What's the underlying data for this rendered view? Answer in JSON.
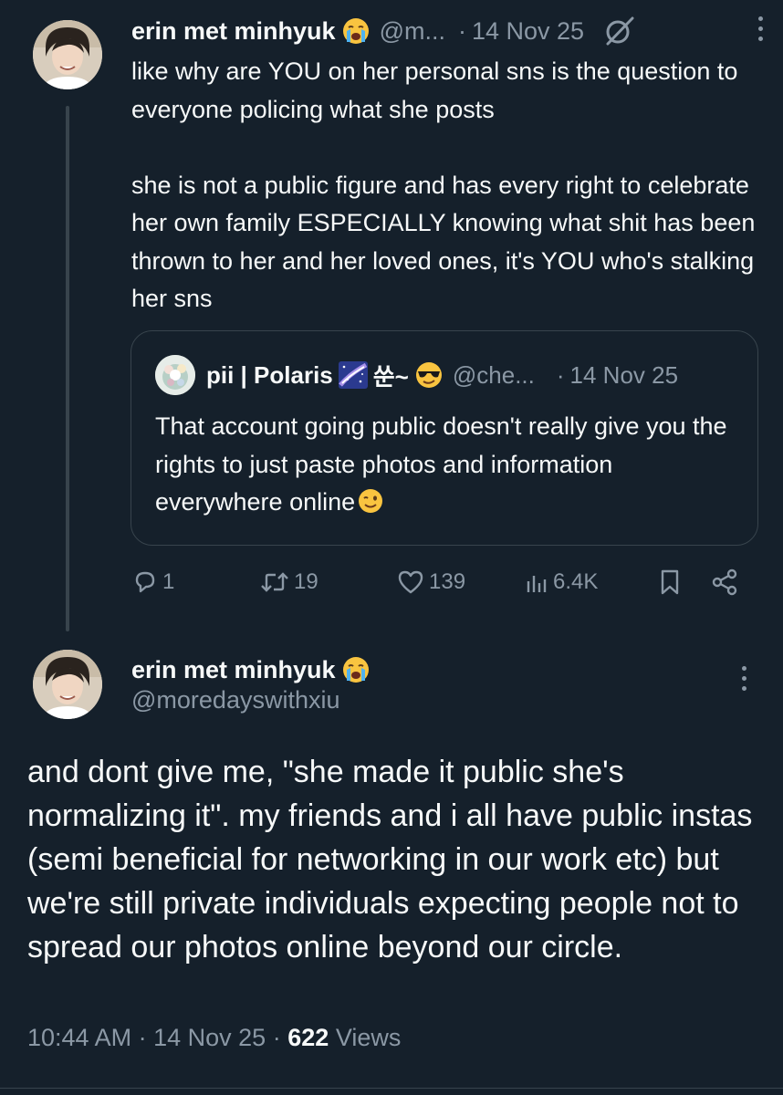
{
  "colors": {
    "background": "#15202b",
    "text_primary": "#f7f9f9",
    "text_secondary": "#8b98a5",
    "border": "#38444d"
  },
  "tweet1": {
    "display_name": "erin met minhyuk",
    "name_emoji": "crying-face-icon",
    "handle": "@m...",
    "separator": "·",
    "date": "14 Nov 25",
    "paragraphs": [
      "like why are YOU on her personal sns is the question to everyone policing what she posts",
      "she is not a public figure and has every right to celebrate her own family ESPECIALLY knowing what shit has been thrown to her and her loved ones, it's YOU who's stalking her sns"
    ],
    "quote": {
      "display_name": "pii | Polaris",
      "name_suffix": "쑨~",
      "handle": "@che...",
      "separator": "·",
      "date": "14 Nov 25",
      "text": "That account going public doesn't really give you the rights to just paste photos and information everywhere online"
    },
    "actions": {
      "replies": "1",
      "reposts": "19",
      "likes": "139",
      "views": "6.4K"
    }
  },
  "tweet2": {
    "display_name": "erin met minhyuk",
    "handle": "@moredayswithxiu",
    "text": "and dont give me, \"she made it public she's normalizing it\". my friends and i all have public instas (semi beneficial for networking in our work etc) but we're still private individuals expecting people not to spread our photos online beyond our circle.",
    "time": "10:44 AM",
    "separator1": "·",
    "date": "14 Nov 25",
    "separator2": "·",
    "views_count": "622",
    "views_label": "Views"
  }
}
